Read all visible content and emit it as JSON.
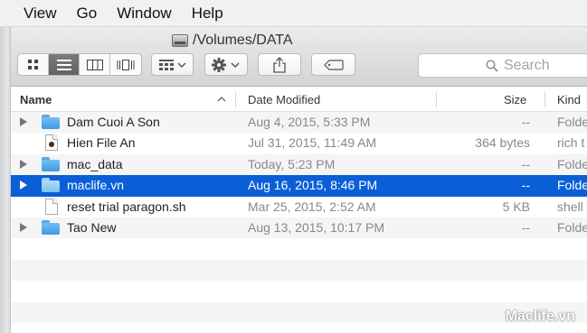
{
  "menu": [
    "View",
    "Go",
    "Window",
    "Help"
  ],
  "window": {
    "title": "/Volumes/DATA"
  },
  "toolbar": {
    "view_modes": [
      "icon-view",
      "list-view",
      "column-view",
      "coverflow-view"
    ],
    "active_view": 1,
    "arrange_icon": "arrange-icon",
    "action_icon": "gear-icon",
    "share_icon": "share-icon",
    "tag_icon": "tag-icon",
    "search_placeholder": "Search"
  },
  "columns": {
    "name": "Name",
    "date": "Date Modified",
    "size": "Size",
    "kind": "Kind"
  },
  "rows": [
    {
      "name": "Dam Cuoi A Son",
      "date": "Aug 4, 2015, 5:33 PM",
      "size": "--",
      "kind": "Folde",
      "type": "folder",
      "expandable": true,
      "selected": false
    },
    {
      "name": "Hien File An",
      "date": "Jul 31, 2015, 11:49 AM",
      "size": "364 bytes",
      "kind": "rich t",
      "type": "document",
      "expandable": false,
      "selected": false
    },
    {
      "name": "mac_data",
      "date": "Today, 5:23 PM",
      "size": "--",
      "kind": "Folde",
      "type": "folder",
      "expandable": true,
      "selected": false
    },
    {
      "name": "maclife.vn",
      "date": "Aug 16, 2015, 8:46 PM",
      "size": "--",
      "kind": "Folde",
      "type": "folder",
      "expandable": true,
      "selected": true
    },
    {
      "name": "reset trial paragon.sh",
      "date": "Mar 25, 2015, 2:52 AM",
      "size": "5 KB",
      "kind": "shell",
      "type": "document",
      "expandable": false,
      "selected": false
    },
    {
      "name": "Tao New",
      "date": "Aug 13, 2015, 10:17 PM",
      "size": "--",
      "kind": "Folde",
      "type": "folder",
      "expandable": true,
      "selected": false
    }
  ],
  "watermark": "Maclife.vn",
  "colors": {
    "selection": "#0a5fd7",
    "folder": "#4aa6ea"
  }
}
